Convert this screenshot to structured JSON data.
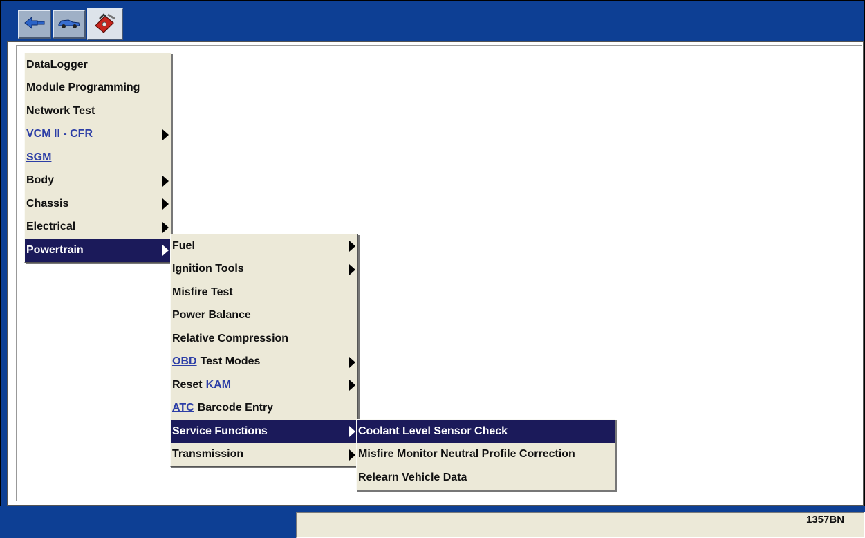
{
  "toolbar": {
    "buttons": [
      {
        "icon": "connector-icon",
        "active": false
      },
      {
        "icon": "vehicle-icon",
        "active": false
      },
      {
        "icon": "toolbox-icon",
        "active": true
      }
    ]
  },
  "menu_main": {
    "items": [
      {
        "label": "DataLogger",
        "submenu": false
      },
      {
        "label": "Module Programming",
        "submenu": false
      },
      {
        "label": "Network Test",
        "submenu": false
      },
      {
        "link": "VCM II - CFR",
        "submenu": true
      },
      {
        "link": "SGM",
        "submenu": false
      },
      {
        "label": "Body",
        "submenu": true
      },
      {
        "label": "Chassis",
        "submenu": true
      },
      {
        "label": "Electrical",
        "submenu": true
      },
      {
        "label": "Powertrain",
        "submenu": true,
        "selected": true
      }
    ]
  },
  "menu_powertrain": {
    "items": [
      {
        "label": "Fuel",
        "submenu": true
      },
      {
        "label": "Ignition Tools",
        "submenu": true
      },
      {
        "label": "Misfire Test",
        "submenu": false
      },
      {
        "label": "Power Balance",
        "submenu": false
      },
      {
        "label": "Relative Compression",
        "submenu": false
      },
      {
        "link": "OBD",
        "label": "Test Modes",
        "submenu": true
      },
      {
        "label": "Reset",
        "link_after": "KAM",
        "submenu": true
      },
      {
        "link": "ATC",
        "label": "Barcode Entry",
        "submenu": false
      },
      {
        "label": "Service Functions",
        "submenu": true,
        "selected": true
      },
      {
        "label": "Transmission",
        "submenu": true
      }
    ]
  },
  "menu_service": {
    "items": [
      {
        "label": "Coolant Level Sensor Check",
        "selected": true
      },
      {
        "label": "Misfire Monitor Neutral Profile Correction"
      },
      {
        "label": "Relearn Vehicle Data"
      }
    ]
  },
  "figure_id": "1357BN",
  "colors": {
    "title_bar": "#0d3f94",
    "menu_bg": "#ece9d8",
    "selection": "#1b1a5a",
    "link": "#2c3ea6"
  }
}
